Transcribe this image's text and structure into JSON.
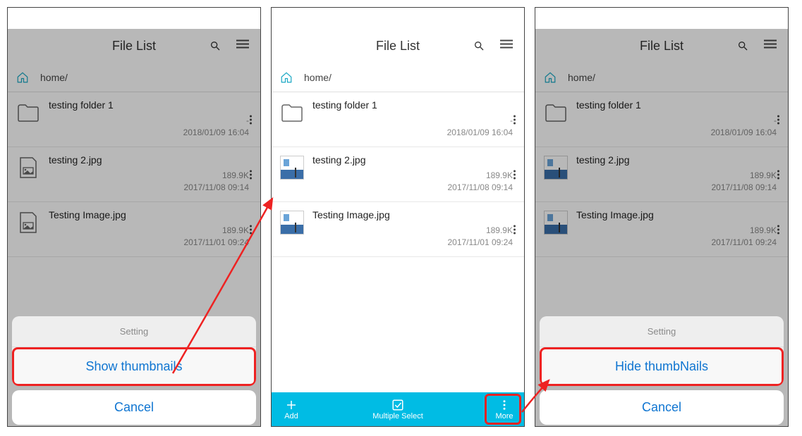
{
  "header": {
    "title": "File List"
  },
  "breadcrumb": "home/",
  "files": [
    {
      "name": "testing folder 1",
      "size": "-",
      "date": "2018/01/09 16:04",
      "type": "folder"
    },
    {
      "name": "testing 2.jpg",
      "size": "189.9K",
      "date": "2017/11/08 09:14",
      "type": "image"
    },
    {
      "name": "Testing Image.jpg",
      "size": "189.9K",
      "date": "2017/11/01 09:24",
      "type": "image"
    }
  ],
  "sheet": {
    "heading": "Setting",
    "show": "Show thumbnails",
    "hide": "Hide thumbNails",
    "cancel": "Cancel"
  },
  "bottombar": {
    "add": "Add",
    "multi": "Multiple Select",
    "more": "More"
  }
}
